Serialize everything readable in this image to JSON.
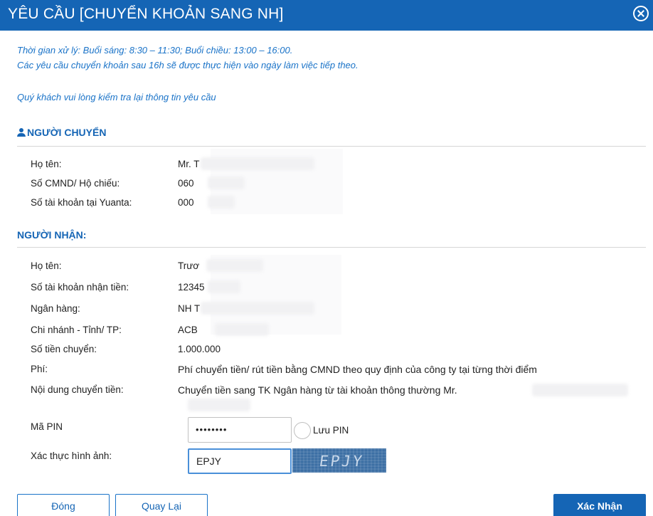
{
  "dialog": {
    "title": "YÊU CẦU [CHUYỂN KHOẢN SANG NH]"
  },
  "notes": {
    "line1": "Thời gian xử lý: Buổi sáng: 8:30 – 11:30; Buổi chiều: 13:00 – 16:00.",
    "line2": "Các yêu cầu chuyển khoản sau 16h sẽ được thực hiện vào ngày làm việc tiếp theo.",
    "line3": "Quý khách vui lòng kiểm tra lại thông tin yêu cầu"
  },
  "sender": {
    "title": "NGƯỜI CHUYỂN",
    "name_label": "Họ tên:",
    "name_value": "Mr. T",
    "id_label": "Số CMND/ Hộ chiếu:",
    "id_value": "060",
    "account_label": "Số tài khoản tại Yuanta:",
    "account_value": "000"
  },
  "receiver": {
    "title": "NGƯỜI NHẬN:",
    "name_label": "Họ tên:",
    "name_value": "Trươ",
    "account_label": "Số tài khoản nhận tiền:",
    "account_value": "12345",
    "bank_label": "Ngân hàng:",
    "bank_value": "NH T",
    "branch_label": "Chi nhánh - Tỉnh/ TP:",
    "branch_value": "ACB",
    "amount_label": "Số tiền chuyển:",
    "amount_value": "1.000.000",
    "fee_label": "Phí:",
    "fee_value": "Phí chuyển tiền/ rút tiền bằng CMND theo quy định của công ty tại từng thời điểm",
    "content_label": "Nội dung chuyển tiền:",
    "content_value": "Chuyển tiền sang TK Ngân hàng từ tài khoản thông thường Mr."
  },
  "form": {
    "pin_label": "Mã PIN",
    "pin_value": "••••••••",
    "save_pin_label": "Lưu PIN",
    "captcha_label": "Xác thực hình ảnh:",
    "captcha_input_value": "EPJY",
    "captcha_image_text": "EPJY"
  },
  "buttons": {
    "close": "Đóng",
    "back": "Quay Lại",
    "confirm": "Xác Nhận"
  },
  "colors": {
    "primary": "#1565b5",
    "note": "#1a73c8"
  },
  "icons": {
    "close": "close-circle-icon",
    "person": "user-icon"
  }
}
